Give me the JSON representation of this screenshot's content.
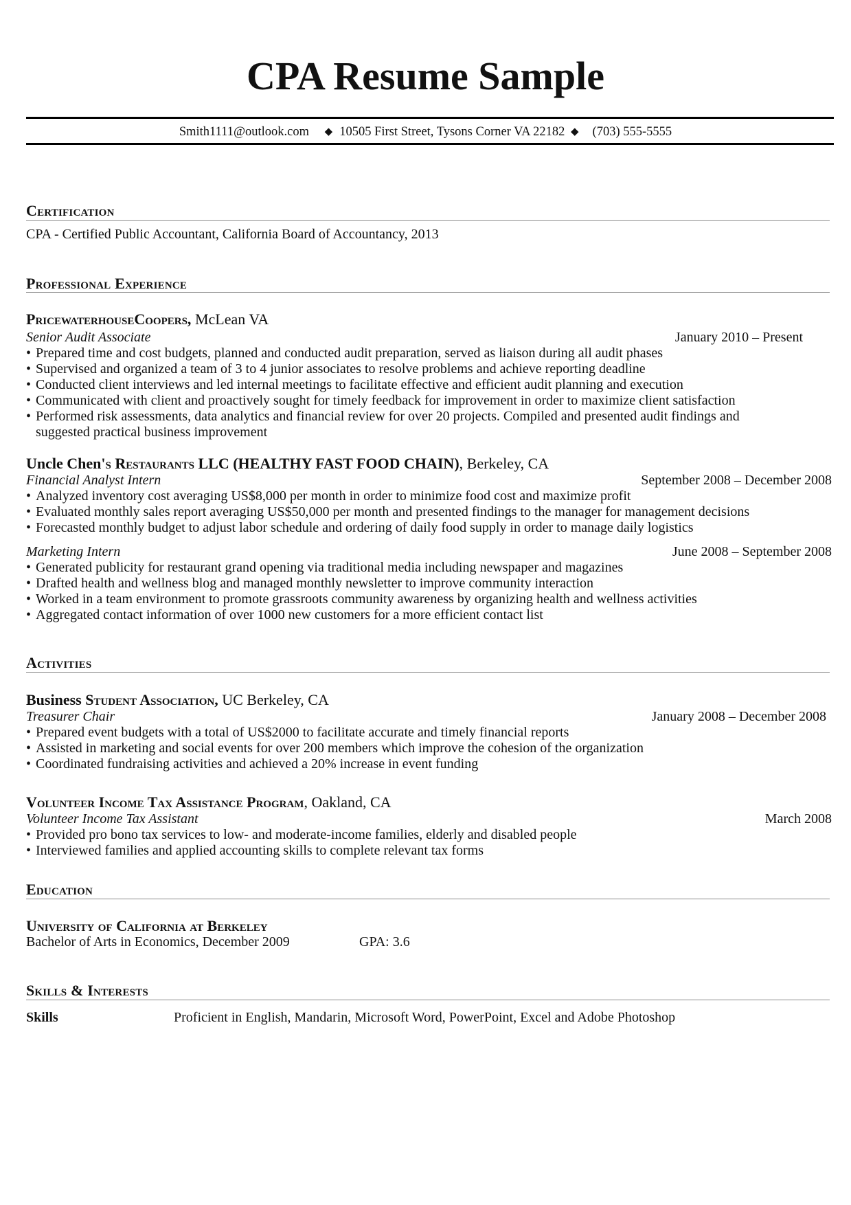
{
  "title": "CPA Resume Sample",
  "contact": {
    "email": "Smith1111@outlook.com",
    "separator_icon": "black-diamond-icon",
    "separator_glyph": "◆",
    "address": "10505 First Street, Tysons Corner VA 22182",
    "phone": "(703) 555-5555"
  },
  "bullet_glyph": "•",
  "sections": {
    "certification": {
      "heading": "Certification",
      "text": "CPA - Certified Public Accountant, California Board of Accountancy, 2013"
    },
    "experience": {
      "heading": "Professional Experience",
      "jobs": [
        {
          "org_bold": "PricewaterhouseCoopers,",
          "org_location": " McLean VA",
          "role": "Senior Audit Associate",
          "dates": "January 2010 – Present",
          "bullets": [
            "Prepared time and cost budgets, planned and conducted audit preparation, served as liaison during all audit phases",
            "Supervised and organized a team of 3 to 4 junior associates to resolve problems and achieve reporting deadline",
            "Conducted client interviews and led internal meetings to facilitate effective and efficient audit planning and execution",
            "Communicated with client and proactively sought for timely feedback for improvement in order to maximize client satisfaction",
            "Performed risk assessments, data analytics and financial review for over 20 projects. Compiled and presented audit findings and"
          ],
          "bullet_continuation": "suggested practical business improvement"
        },
        {
          "org_plain": "Uncle Chen",
          "org_bold": "'s Restaurants LLC (HEALTHY FAST FOOD CHAIN)",
          "org_location": ", Berkeley, CA",
          "role": "Financial Analyst Intern",
          "dates": "September 2008 – December 2008",
          "bullets": [
            "Analyzed inventory cost averaging US$8,000 per month in order to minimize food cost and maximize profit",
            "Evaluated monthly sales report averaging US$50,000 per month and presented findings to the manager for management decisions",
            "Forecasted monthly budget to adjust labor schedule and ordering of daily food supply in order to manage daily logistics"
          ]
        },
        {
          "role": "Marketing Intern",
          "dates": "June 2008 – September 2008",
          "bullets": [
            "Generated publicity for restaurant grand opening via traditional media including newspaper and magazines",
            "Drafted health and wellness blog and managed monthly newsletter to improve community interaction",
            "Worked in a team environment to promote grassroots community awareness by organizing health and wellness activities",
            "Aggregated contact information of over 1000 new customers for a more efficient contact list"
          ]
        }
      ]
    },
    "activities": {
      "heading": "Activities",
      "items": [
        {
          "org_plain": "Business",
          "org_bold": " Student Association,",
          "org_location": " UC Berkeley, CA",
          "role": "Treasurer Chair",
          "dates": "January 2008 – December 2008",
          "bullets": [
            "Prepared event budgets with a total of US$2000 to facilitate accurate and timely financial reports",
            "Assisted in marketing and social events for over 200 members which improve the cohesion of the organization",
            "Coordinated fundraising activities and achieved a 20% increase in event funding"
          ]
        },
        {
          "org_bold": "Volunteer Income Tax Assistance Program",
          "org_location": ", Oakland, CA",
          "role": "Volunteer Income Tax Assistant",
          "dates": "March 2008",
          "bullets": [
            "Provided pro bono tax services to low- and moderate-income families, elderly and disabled people",
            "Interviewed families and applied accounting skills to complete relevant tax forms"
          ]
        }
      ]
    },
    "education": {
      "heading": "Education",
      "school": "University of California at Berkeley",
      "degree": "Bachelor of Arts in Economics, December 2009",
      "gpa": "GPA: 3.6"
    },
    "skills": {
      "heading": "Skills & Interests",
      "label": "Skills",
      "value": "Proficient in English, Mandarin, Microsoft Word, PowerPoint, Excel and Adobe Photoshop"
    }
  }
}
